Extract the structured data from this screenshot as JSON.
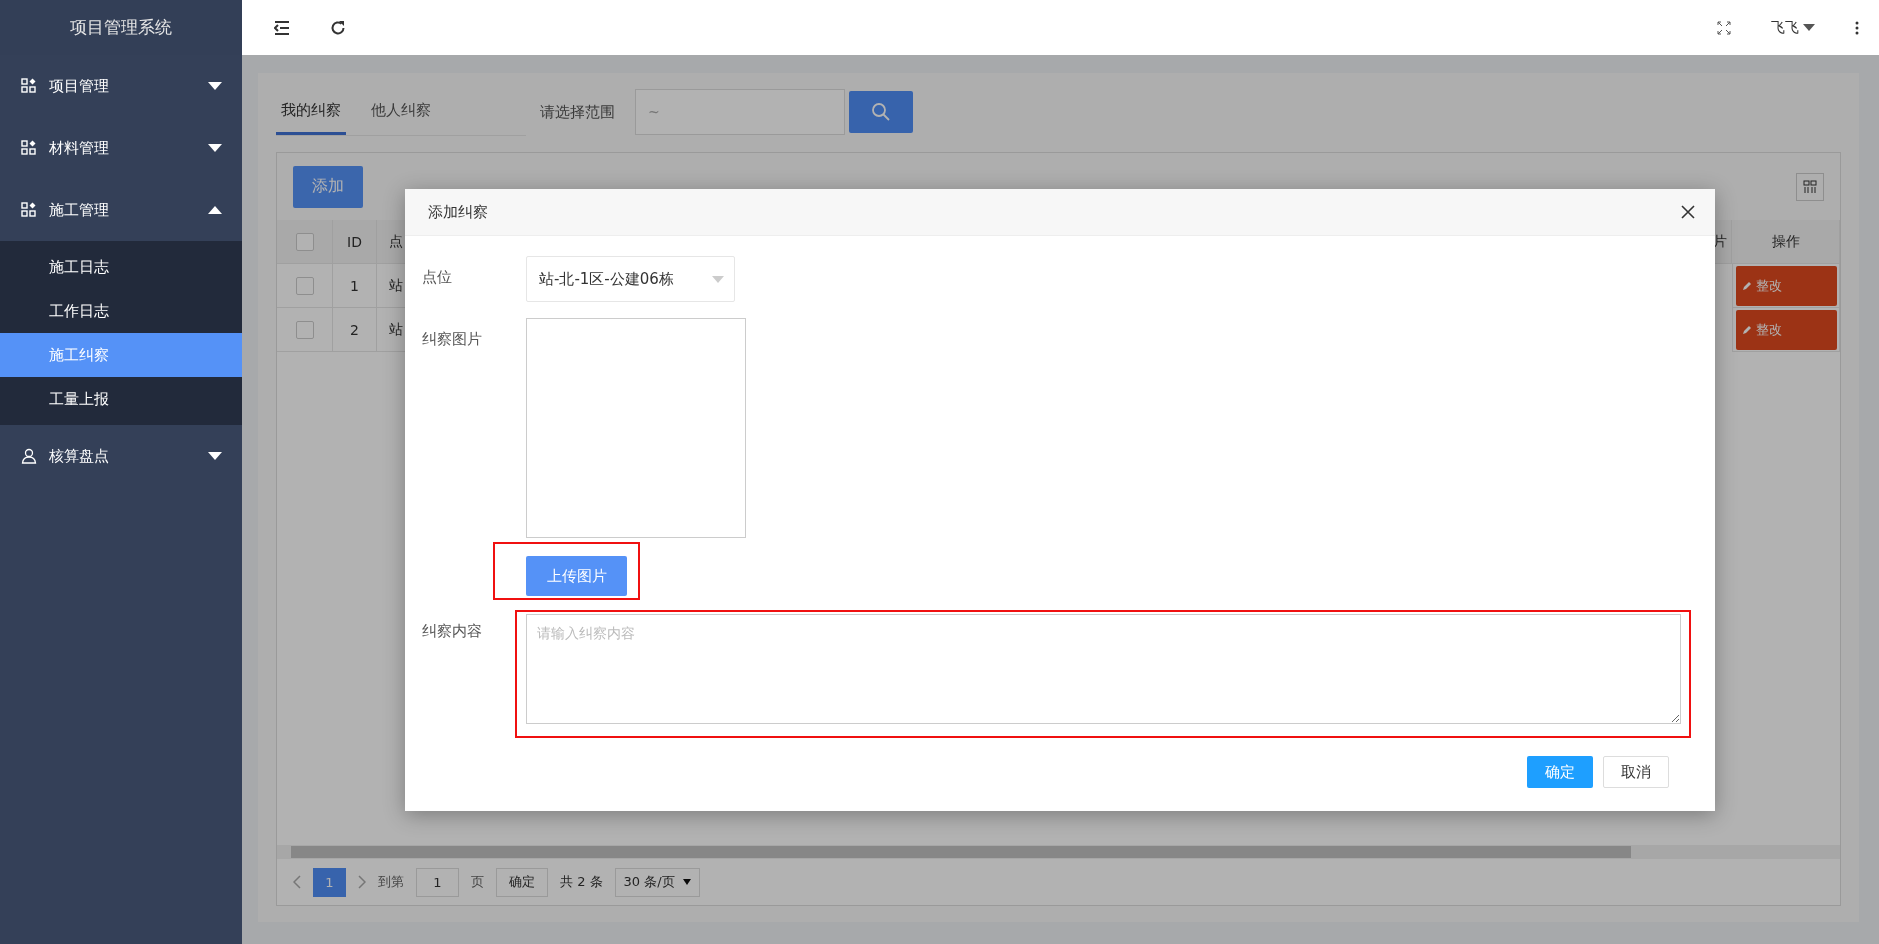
{
  "sidebar": {
    "title": "项目管理系统",
    "menus": [
      {
        "label": "项目管理",
        "expanded": false
      },
      {
        "label": "材料管理",
        "expanded": false
      },
      {
        "label": "施工管理",
        "expanded": true,
        "children": [
          {
            "label": "施工日志",
            "selected": false
          },
          {
            "label": "工作日志",
            "selected": false
          },
          {
            "label": "施工纠察",
            "selected": true
          },
          {
            "label": "工量上报",
            "selected": false
          }
        ]
      },
      {
        "label": "核算盘点",
        "expanded": false
      }
    ]
  },
  "header": {
    "user": "飞飞"
  },
  "tabs": [
    {
      "label": "我的纠察",
      "selected": true
    },
    {
      "label": "他人纠察",
      "selected": false
    }
  ],
  "range_filter": {
    "label": "请选择范围",
    "placeholder": "~"
  },
  "toolbar": {
    "add_button": "添加"
  },
  "table": {
    "select_all": {
      "checked": false
    },
    "columns": [
      "ID",
      "点",
      "片",
      "操作"
    ],
    "rows": [
      {
        "checked": false,
        "id": "1",
        "column_3": "站",
        "action": "整改"
      },
      {
        "checked": false,
        "id": "2",
        "column_3": "站",
        "action": "整改"
      }
    ]
  },
  "pagination": {
    "pages": [
      {
        "label": "1",
        "selected": true
      }
    ],
    "goto_label": "到第",
    "goto_value": "1",
    "page_unit": "页",
    "goto_button": "确定",
    "total": "共 2 条",
    "page_size": "30 条/页"
  },
  "dialog": {
    "title": "添加纠察",
    "location_label": "点位",
    "location_value": "站-北-1区-公建06栋",
    "image_label": "纠察图片",
    "upload_button": "上传图片",
    "content_label": "纠察内容",
    "content_placeholder": "请输入纠察内容",
    "confirm": "确定",
    "cancel": "取消"
  },
  "annotations": [
    {
      "kind": "frame"
    },
    {
      "kind": "frame"
    }
  ]
}
